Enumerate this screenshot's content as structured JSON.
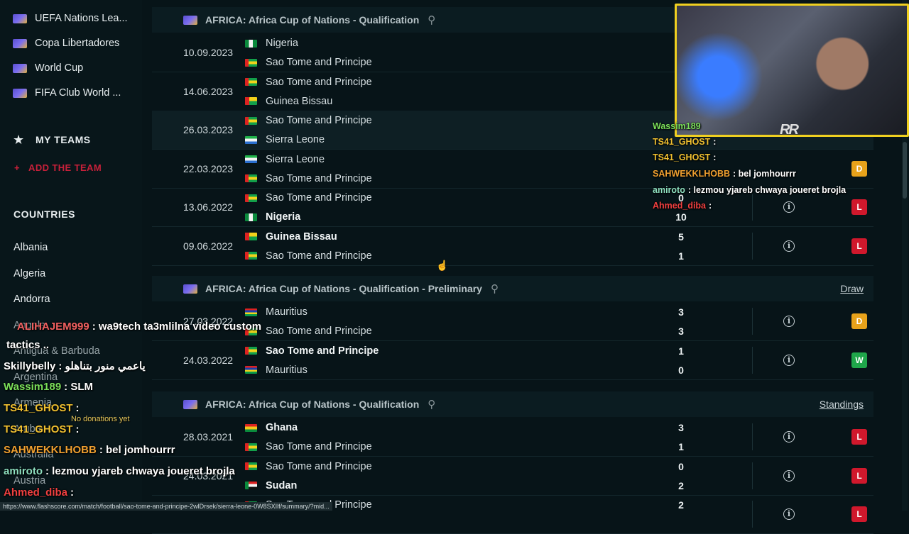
{
  "sidebar": {
    "leagues": [
      {
        "label": "UEFA Nations Lea..."
      },
      {
        "label": "Copa Libertadores"
      },
      {
        "label": "World Cup"
      },
      {
        "label": "FIFA Club World ..."
      }
    ],
    "my_teams_title": "MY TEAMS",
    "add_team_label": "ADD THE TEAM",
    "countries_title": "COUNTRIES",
    "countries": [
      "Albania",
      "Algeria",
      "Andorra",
      "Angola",
      "Antigua & Barbuda",
      "Argentina",
      "Armenia",
      "Aruba",
      "Australia",
      "Austria"
    ]
  },
  "sections": [
    {
      "title": "AFRICA: Africa Cup of Nations - Qualification",
      "link": "",
      "matches": [
        {
          "date": "10.09.2023",
          "home": "Nigeria",
          "away": "Sao Tome and Principe",
          "hs": "",
          "as": "",
          "result": ""
        },
        {
          "date": "14.06.2023",
          "home": "Sao Tome and Principe",
          "away": "Guinea Bissau",
          "hs": "",
          "as": "",
          "result": ""
        },
        {
          "date": "26.03.2023",
          "home": "Sao Tome and Principe",
          "away": "Sierra Leone",
          "hs": "",
          "as": "",
          "result": ""
        },
        {
          "date": "22.03.2023",
          "home": "Sierra Leone",
          "away": "Sao Tome and Principe",
          "hs": "",
          "as": "",
          "result": "D"
        },
        {
          "date": "13.06.2022",
          "home": "Sao Tome and Principe",
          "away": "Nigeria",
          "hs": "0",
          "as": "10",
          "result": "L"
        },
        {
          "date": "09.06.2022",
          "home": "Guinea Bissau",
          "away": "Sao Tome and Principe",
          "hs": "5",
          "as": "1",
          "result": "L"
        }
      ]
    },
    {
      "title": "AFRICA: Africa Cup of Nations - Qualification - Preliminary",
      "link": "Draw",
      "matches": [
        {
          "date": "27.03.2022",
          "home": "Mauritius",
          "away": "Sao Tome and Principe",
          "hs": "3",
          "as": "3",
          "result": "D"
        },
        {
          "date": "24.03.2022",
          "home": "Sao Tome and Principe",
          "away": "Mauritius",
          "hs": "1",
          "as": "0",
          "result": "W"
        }
      ]
    },
    {
      "title": "AFRICA: Africa Cup of Nations - Qualification",
      "link": "Standings",
      "matches": [
        {
          "date": "28.03.2021",
          "home": "Ghana",
          "away": "Sao Tome and Principe",
          "hs": "3",
          "as": "1",
          "result": "L"
        },
        {
          "date": "24.03.2021",
          "home": "Sao Tome and Principe",
          "away": "Sudan",
          "hs": "0",
          "as": "2",
          "result": "L"
        },
        {
          "date": "",
          "home": "Sao Tome and Principe",
          "away": "",
          "hs": "2",
          "as": "",
          "result": "L"
        }
      ]
    }
  ],
  "chat_right": [
    {
      "user": "Wassim189",
      "msg": "",
      "color": "#7be05a"
    },
    {
      "user": "TS41_GHOST",
      "msg": ":",
      "color": "#f0c030"
    },
    {
      "user": "TS41_GHOST",
      "msg": ":",
      "color": "#f0c030"
    },
    {
      "user": "SAHWEKKLHOBB",
      "msg": ": bel jomhourrr",
      "color": "#f0a030"
    },
    {
      "user": "amiroto",
      "msg": ": lezmou yjareb chwaya joueret brojla",
      "color": "#8ee0c0"
    },
    {
      "user": "Ahmed_diba",
      "msg": ":",
      "color": "#f04040"
    }
  ],
  "chat_left": [
    {
      "user": "ALIHAJEM999",
      "msg": ": wa9tech ta3mlilna video custom",
      "color": "#f06060"
    },
    {
      "user": "",
      "msg": "tactics ..",
      "color": "#ffffff"
    },
    {
      "user": "Skillybelly",
      "msg": ": ياعمي منور بتناهلو",
      "color": "#ffffff"
    },
    {
      "user": "Wassim189",
      "msg": ": SLM",
      "color": "#7be05a"
    },
    {
      "user": "TS41_GHOST",
      "msg": ":",
      "color": "#f0c030"
    },
    {
      "user": "TS41_GHOST",
      "msg": ":",
      "color": "#f0c030"
    },
    {
      "user": "SAHWEKKLHOBB",
      "msg": ": bel jomhourrr",
      "color": "#f0a030"
    },
    {
      "user": "amiroto",
      "msg": ": lezmou yjareb chwaya joueret brojla",
      "color": "#8ee0c0"
    },
    {
      "user": "Ahmed_diba",
      "msg": ":",
      "color": "#f04040"
    }
  ],
  "donation_text": "No donations yet",
  "webcam_logo": "RR",
  "status_url": "https://www.flashscore.com/match/football/sao-tome-and-principe-2wlDrsek/sierra-leone-0W8SXIlf/summary/?mid..."
}
